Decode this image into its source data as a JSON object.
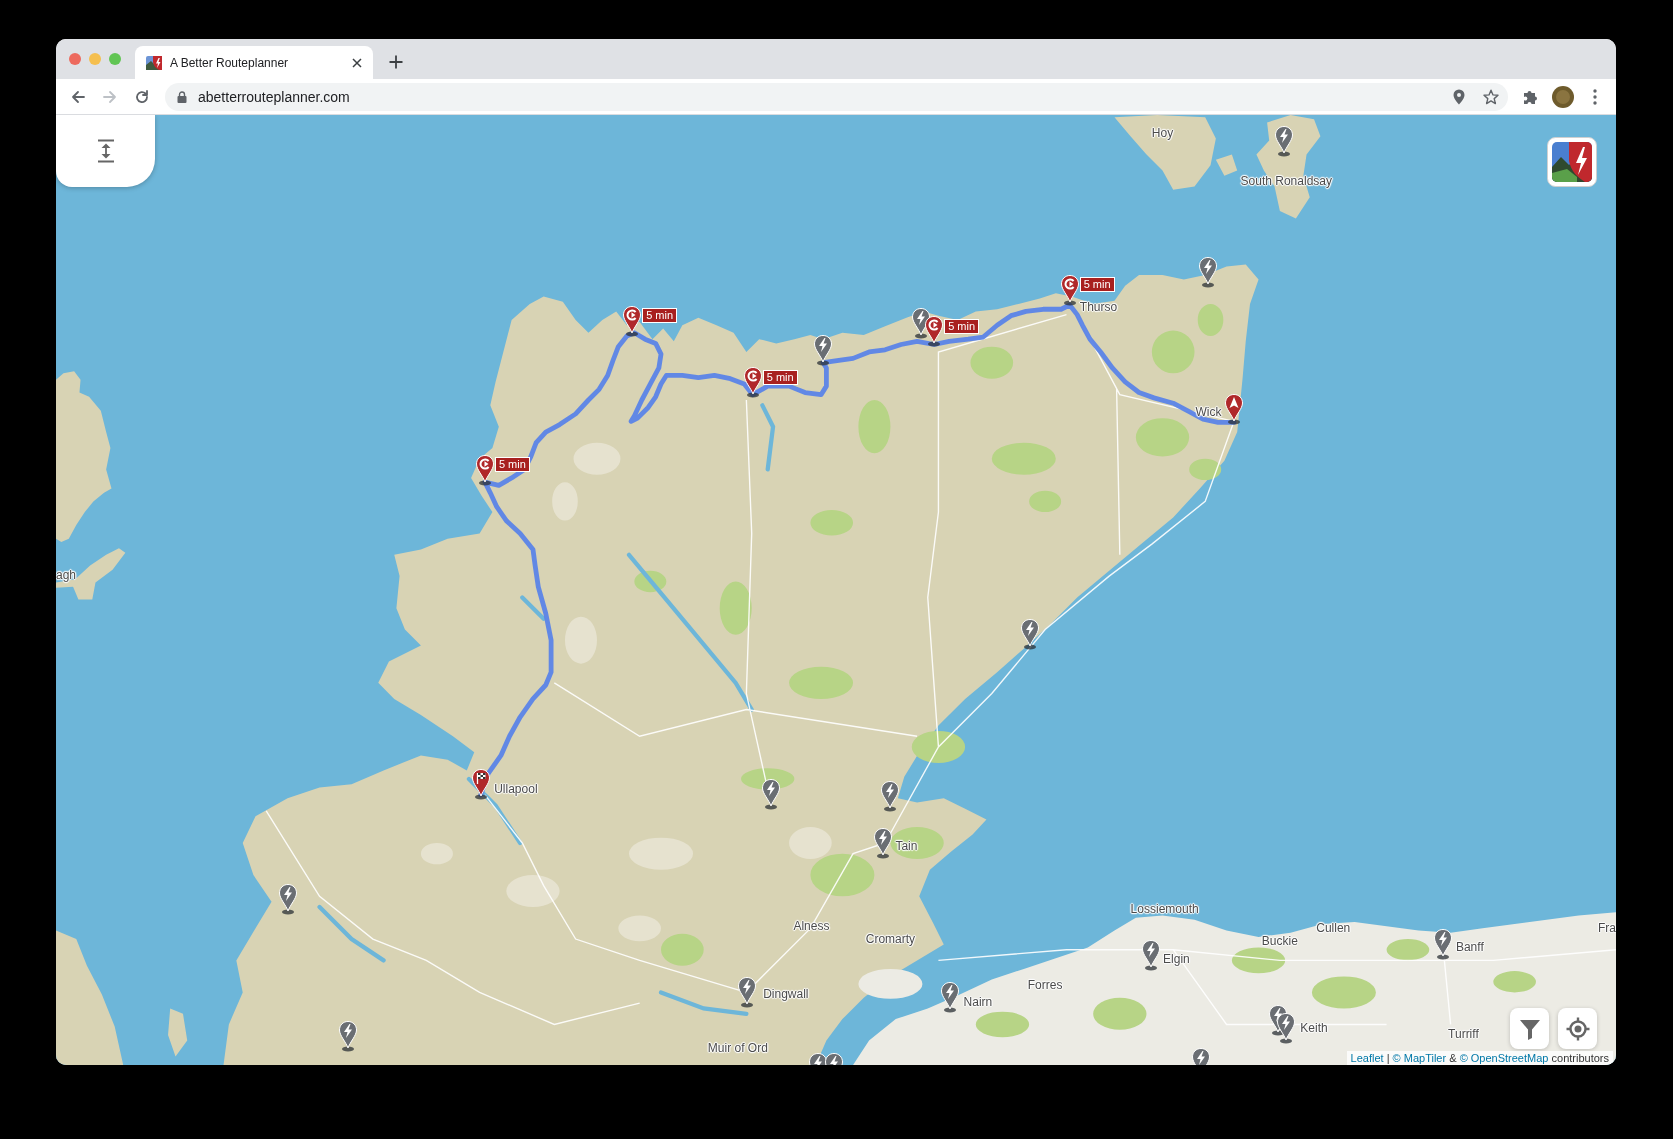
{
  "window": {
    "tabs": [
      {
        "title": "A Better Routeplanner",
        "selected": true
      }
    ]
  },
  "toolbar": {
    "nav": [
      {
        "kind": "back",
        "disabled": false
      },
      {
        "kind": "forward",
        "disabled": true
      },
      {
        "kind": "reload",
        "disabled": false
      }
    ],
    "url": "abetterrouteplanner.com"
  },
  "map": {
    "route": [
      {
        "kind": "start"
      },
      {
        "kind": "charge",
        "label": "5 min"
      },
      {
        "kind": "charge",
        "label": "5 min"
      },
      {
        "kind": "charge",
        "label": "5 min"
      },
      {
        "kind": "charge",
        "label": "5 min"
      },
      {
        "kind": "charge",
        "label": "5 min"
      },
      {
        "kind": "destination"
      }
    ],
    "places": [
      "Hoy",
      "South Ronaldsay",
      "Thurso",
      "Wick",
      "agh",
      "Ullapool",
      "Tain",
      "Lossiemouth",
      "Alness",
      "Cullen",
      "Fra",
      "Cromarty",
      "Buckie",
      "Banff",
      "Elgin",
      "Forres",
      "Dingwall",
      "Nairn",
      "Keith",
      "Turriff",
      "Muir of Ord"
    ],
    "attribution": [
      {
        "kind": "link",
        "text": "Leaflet"
      },
      {
        "kind": "text",
        "text": "|"
      },
      {
        "kind": "link",
        "text": "© MapTiler"
      },
      {
        "kind": "text",
        "text": "&"
      },
      {
        "kind": "link",
        "text": "© OpenStreetMap"
      },
      {
        "kind": "text",
        "text": "contributors"
      }
    ]
  }
}
